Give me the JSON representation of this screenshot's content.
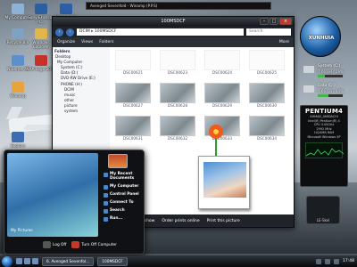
{
  "desktop": {
    "icons": [
      {
        "label": "My Computer",
        "color": "#8db2d6"
      },
      {
        "label": "Sony Ericsson PC...",
        "color": "#2b5fa0"
      },
      {
        "label": "Word 2010",
        "color": "#2d5ea8"
      },
      {
        "label": "Recycle Bin",
        "color": "#7fa2c2"
      },
      {
        "label": "Windows Explorer",
        "color": "#e2b64a"
      },
      {
        "label": "N Series NI",
        "color": "#5b8fd0"
      },
      {
        "label": "AAA Logo 2010",
        "color": "#c6322a"
      },
      {
        "label": "Winamp",
        "color": "#e8a33a"
      },
      {
        "label": "Explore",
        "color": "#3b6eb0"
      }
    ]
  },
  "topbar": {
    "text": "Avenged Sevenfold - Winamp (P.P.S)"
  },
  "explorer": {
    "title": "100MSDCF",
    "address": "DCIM ▸ 100MSDCF",
    "search_placeholder": "Search",
    "toolbar": {
      "organize": "Organize",
      "views": "Views",
      "folders": "Folders",
      "more": "More"
    },
    "sidebar": {
      "header": "Folders",
      "items": [
        "Desktop",
        "My Computer",
        "System (C:)",
        "Data (D:)",
        "DVD-RW Drive (E:)",
        "PHONE (H:)",
        "DCIM",
        "music",
        "other",
        "picture",
        "system"
      ]
    },
    "thumbnails": [
      {
        "name": "DSC00621",
        "filled": false
      },
      {
        "name": "DSC00623",
        "filled": false
      },
      {
        "name": "DSC00624",
        "filled": false
      },
      {
        "name": "DSC00625",
        "filled": false
      },
      {
        "name": "DSC00627",
        "filled": true
      },
      {
        "name": "DSC00628",
        "filled": true
      },
      {
        "name": "DSC00629",
        "filled": true
      },
      {
        "name": "DSC00630",
        "filled": true
      },
      {
        "name": "DSC00631",
        "filled": true
      },
      {
        "name": "DSC00632",
        "filled": true
      },
      {
        "name": "DSC00633",
        "filled": true
      },
      {
        "name": "DSC00634",
        "filled": true
      }
    ],
    "status": {
      "slideshow": "View as a slide show",
      "order": "Order prints online",
      "print": "Print this picture"
    }
  },
  "start_menu": {
    "pictures_title": "My Pictures",
    "items": [
      "My Recent Documents",
      "My Computer",
      "Control Panel",
      "Connect To",
      "Search",
      "Run..."
    ],
    "log_off": "Log Off",
    "turn_off": "Turn Off Computer"
  },
  "gadgets": {
    "orb_label": "XUNHUIA",
    "drives": [
      {
        "name": "System (C:)",
        "size": "7.66 GB / 29%",
        "fill": 0.29
      },
      {
        "name": "Data (D:)",
        "size": "7.66 GB / 44%",
        "fill": 0.44
      }
    ],
    "sysinfo": {
      "logo": "PENTIUM4",
      "lines": [
        "AHMAD_AMIDACHI",
        "Intel(R) Pentium(R) 4",
        "CPU 3.00GHz",
        "2992 MHz",
        "1024MB RAM",
        "Microsoft Windows XP"
      ]
    },
    "clock_label": "LE-Skel"
  },
  "taskbar": {
    "tasks": [
      "6. Avenged Sevenfol...",
      "100MSDCF"
    ],
    "time": "17:48"
  }
}
